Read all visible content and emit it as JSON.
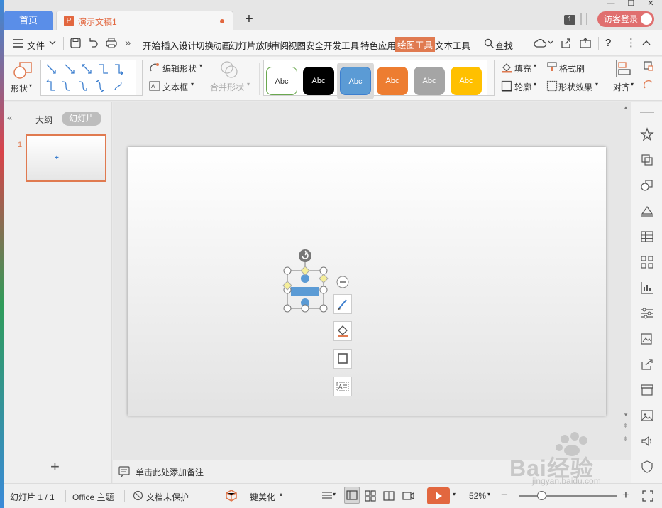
{
  "tabs": {
    "home": "首页",
    "document": "演示文稿1",
    "add": "+"
  },
  "titlebar": {
    "badge": "1",
    "visitor_login": "访客登录"
  },
  "menu": {
    "file": "文件",
    "more": "»",
    "items": [
      "开始",
      "插入",
      "设计",
      "切换",
      "动画",
      "幻灯片放映",
      "审阅",
      "视图",
      "安全",
      "开发工具",
      "特色应用",
      "绘图工具",
      "文本工具"
    ],
    "active": "绘图工具",
    "search": "查找"
  },
  "ribbon": {
    "shape_label": "形状",
    "edit_shape": "编辑形状",
    "text_box": "文本框",
    "merge_shape": "合并形状",
    "style_samples": [
      "Abc",
      "Abc",
      "Abc",
      "Abc",
      "Abc",
      "Abc"
    ],
    "fill": "填充",
    "format_painter": "格式刷",
    "outline": "轮廓",
    "shape_effect": "形状效果",
    "align": "对齐"
  },
  "left_panel": {
    "outline_tab": "大纲",
    "slides_tab": "幻灯片",
    "slide_number": "1",
    "add_slide": "+"
  },
  "notes": {
    "placeholder": "单击此处添加备注"
  },
  "statusbar": {
    "slide_info": "幻灯片 1 / 1",
    "theme": "Office 主题",
    "protection": "文档未保护",
    "beautify": "一键美化",
    "zoom": "52%",
    "zoom_out": "−",
    "zoom_in": "+"
  },
  "watermark": {
    "brand": "Bai经验",
    "url": "jingyan.baidu.com"
  },
  "colors": {
    "accent": "#e07a50",
    "home_tab": "#5a8ee8",
    "visitor": "#e06f6f",
    "shape_blue": "#5b9bd5",
    "handle_yellow": "#f5ee9a"
  }
}
